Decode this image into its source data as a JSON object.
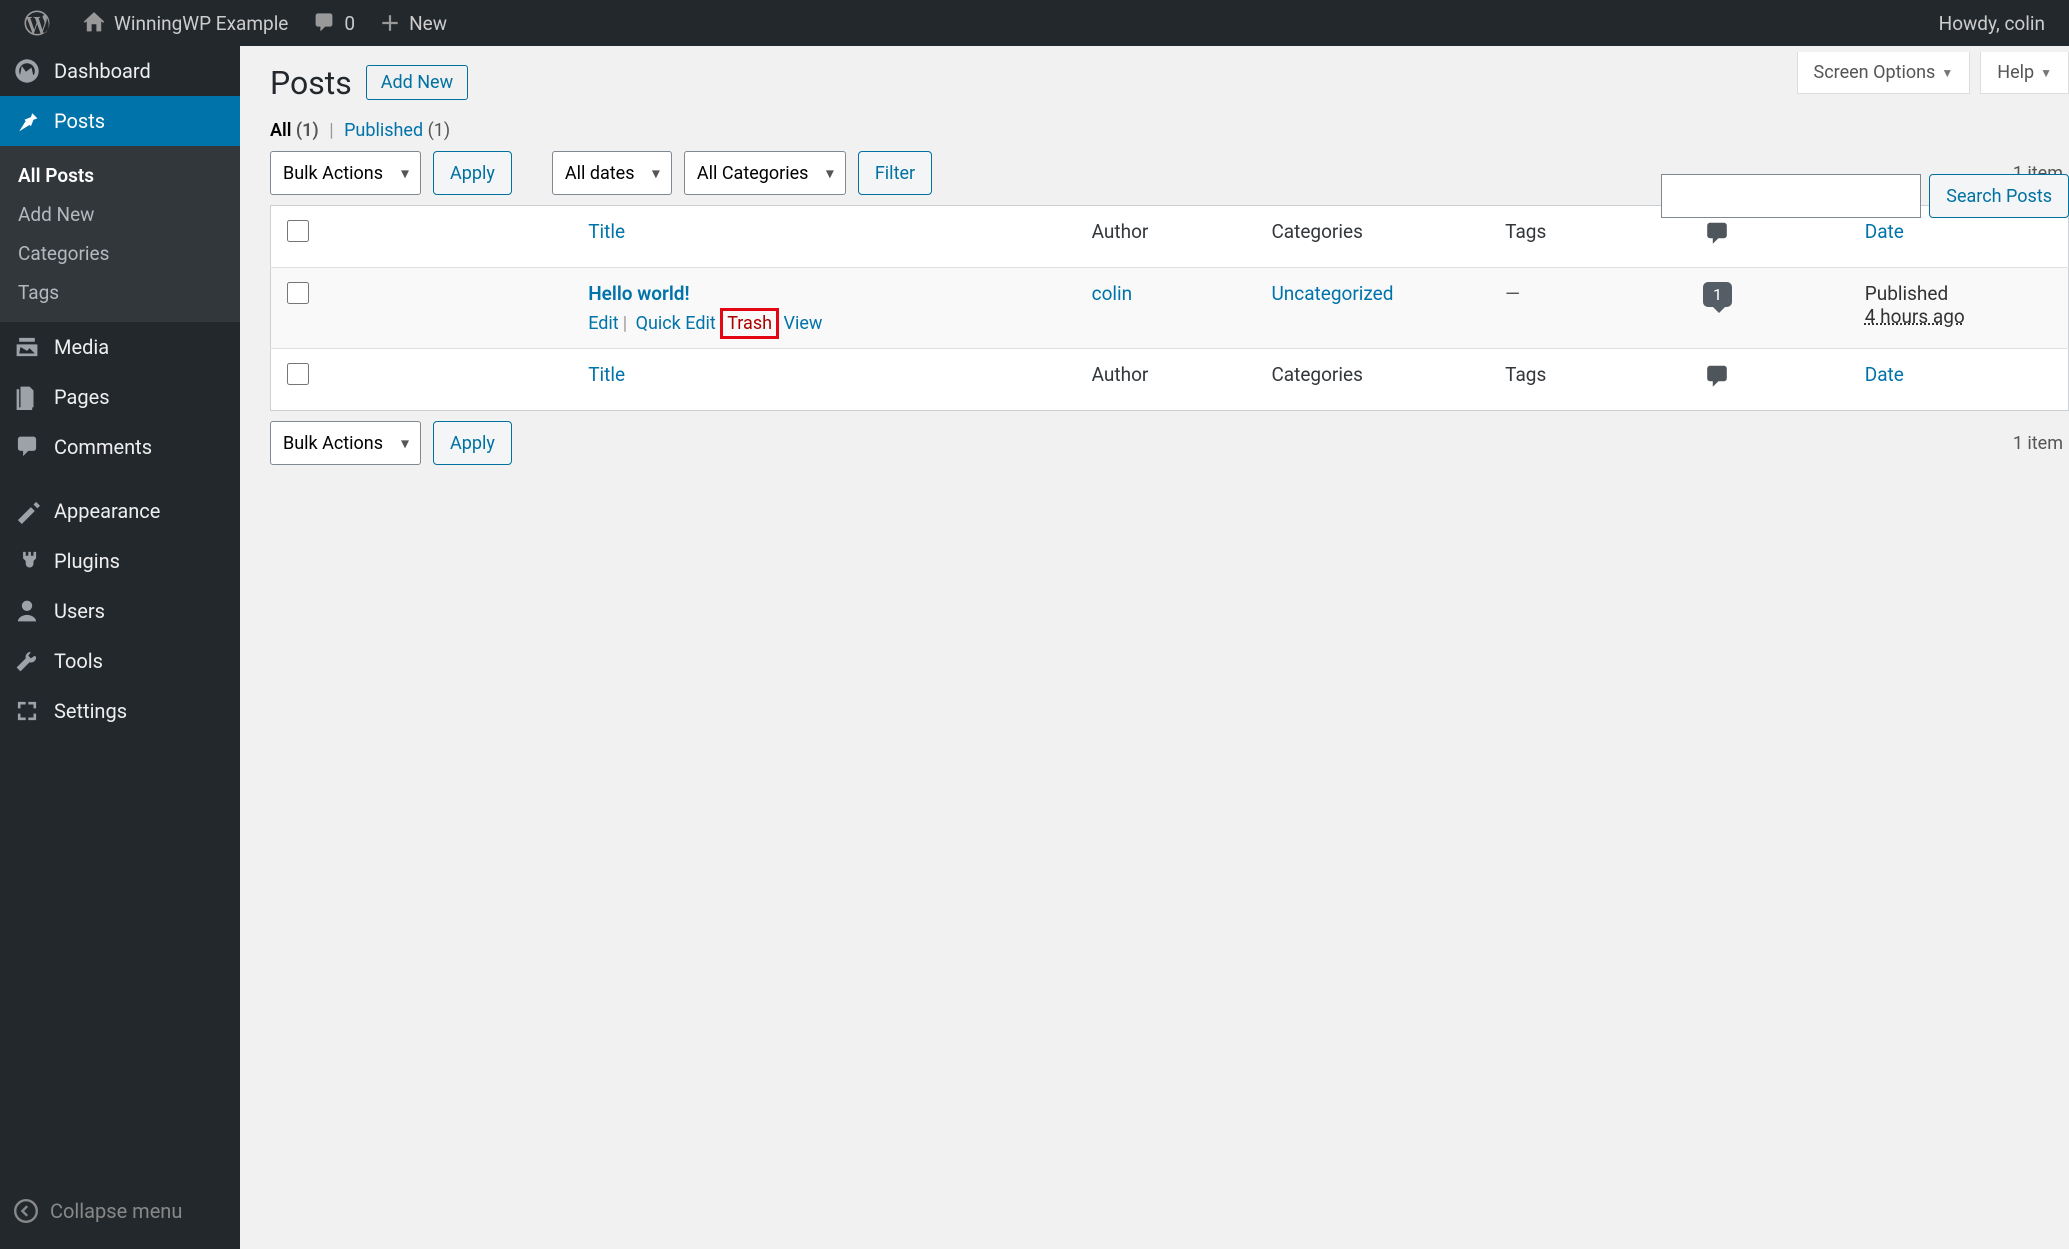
{
  "adminbar": {
    "site_name": "WinningWP Example",
    "comments": "0",
    "new": "New",
    "howdy": "Howdy, colin"
  },
  "sidebar": {
    "items": [
      {
        "label": "Dashboard"
      },
      {
        "label": "Posts"
      },
      {
        "label": "Media"
      },
      {
        "label": "Pages"
      },
      {
        "label": "Comments"
      },
      {
        "label": "Appearance"
      },
      {
        "label": "Plugins"
      },
      {
        "label": "Users"
      },
      {
        "label": "Tools"
      },
      {
        "label": "Settings"
      }
    ],
    "submenu": [
      {
        "label": "All Posts"
      },
      {
        "label": "Add New"
      },
      {
        "label": "Categories"
      },
      {
        "label": "Tags"
      }
    ],
    "collapse": "Collapse menu"
  },
  "screen_meta": {
    "screen_options": "Screen Options",
    "help": "Help"
  },
  "heading": {
    "title": "Posts",
    "add_new": "Add New"
  },
  "subsubsub": {
    "all": "All",
    "all_count": "(1)",
    "sep": "|",
    "published": "Published",
    "published_count": "(1)"
  },
  "search": {
    "button": "Search Posts"
  },
  "tablenav": {
    "bulk": "Bulk Actions",
    "apply": "Apply",
    "dates": "All dates",
    "cats": "All Categories",
    "filter": "Filter",
    "count": "1 item"
  },
  "table": {
    "cols": {
      "title": "Title",
      "author": "Author",
      "categories": "Categories",
      "tags": "Tags",
      "date": "Date"
    },
    "row": {
      "title": "Hello world!",
      "actions": {
        "edit": "Edit",
        "quick_edit": "Quick Edit",
        "trash": "Trash",
        "view": "View"
      },
      "author": "colin",
      "category": "Uncategorized",
      "tags": "—",
      "comment_count": "1",
      "date_state": "Published",
      "date_time": "4 hours ago"
    }
  }
}
